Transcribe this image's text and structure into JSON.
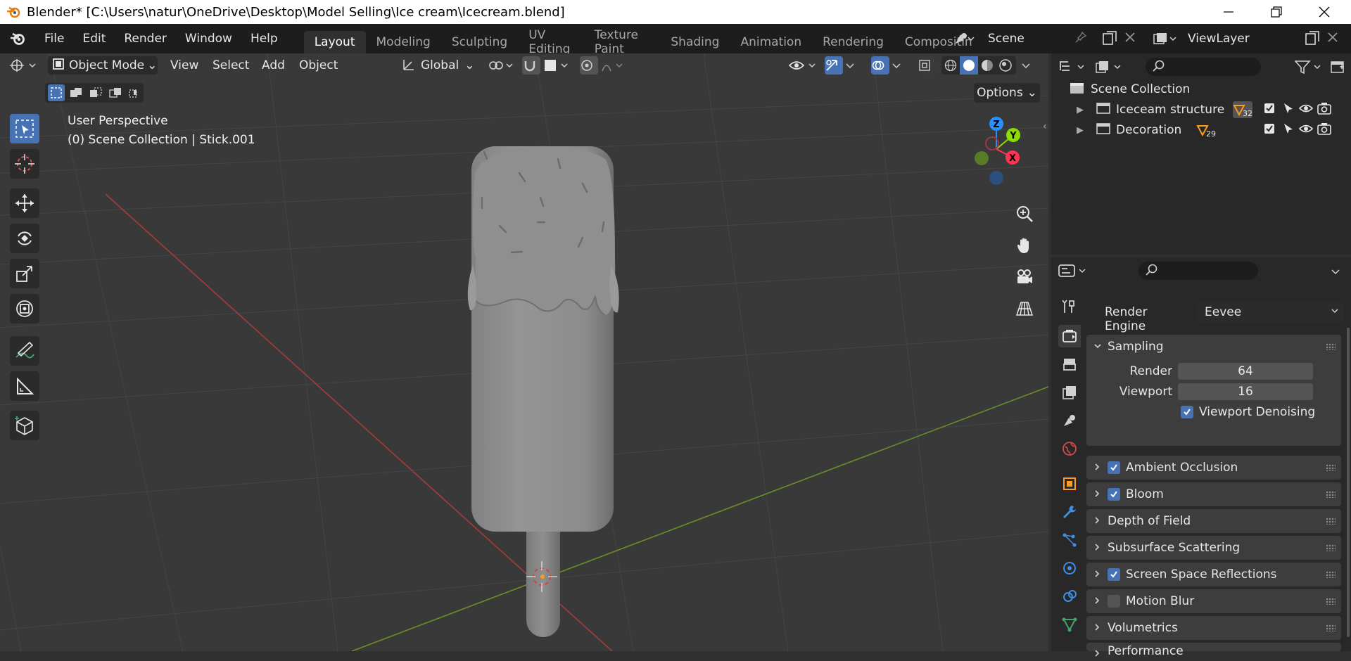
{
  "window": {
    "title": "Blender* [C:\\Users\\natur\\OneDrive\\Desktop\\Model Selling\\Ice cream\\Icecream.blend]"
  },
  "menu": [
    "File",
    "Edit",
    "Render",
    "Window",
    "Help"
  ],
  "workspaces": [
    "Layout",
    "Modeling",
    "Sculpting",
    "UV Editing",
    "Texture Paint",
    "Shading",
    "Animation",
    "Rendering",
    "Compositin"
  ],
  "scene": {
    "name": "Scene"
  },
  "view_layer": {
    "name": "ViewLayer"
  },
  "viewport": {
    "mode": "Object Mode",
    "menus": [
      "View",
      "Select",
      "Add",
      "Object"
    ],
    "transform_orientation": "Global",
    "options_label": "Options",
    "perspective_label": "User Perspective",
    "context_label": "(0) Scene Collection | Stick.001",
    "gizmo": {
      "x": "X",
      "y": "Y",
      "z": "Z"
    }
  },
  "outliner": {
    "root": "Scene Collection",
    "collections": [
      {
        "name": "Iceceam structure",
        "count": "32"
      },
      {
        "name": "Decoration",
        "count": "29"
      }
    ]
  },
  "properties": {
    "render_engine_label": "Render Engine",
    "render_engine": "Eevee",
    "sampling": {
      "title": "Sampling",
      "render_label": "Render",
      "render": 64,
      "viewport_label": "Viewport",
      "viewport": 16,
      "denoise_label": "Viewport Denoising"
    },
    "panels": [
      {
        "label": "Ambient Occlusion",
        "checkbox": true
      },
      {
        "label": "Bloom",
        "checkbox": true
      },
      {
        "label": "Depth of Field",
        "checkbox": null
      },
      {
        "label": "Subsurface Scattering",
        "checkbox": null
      },
      {
        "label": "Screen Space Reflections",
        "checkbox": true
      },
      {
        "label": "Motion Blur",
        "checkbox": false
      },
      {
        "label": "Volumetrics",
        "checkbox": null
      },
      {
        "label": "Performance",
        "checkbox": null
      }
    ]
  },
  "colors": {
    "accent": "#4772b3",
    "x_axis": "#ff3352",
    "y_axis": "#8bdc00",
    "z_axis": "#2890ff",
    "header": "#1d1d1d",
    "viewport_bg": "#393939"
  }
}
